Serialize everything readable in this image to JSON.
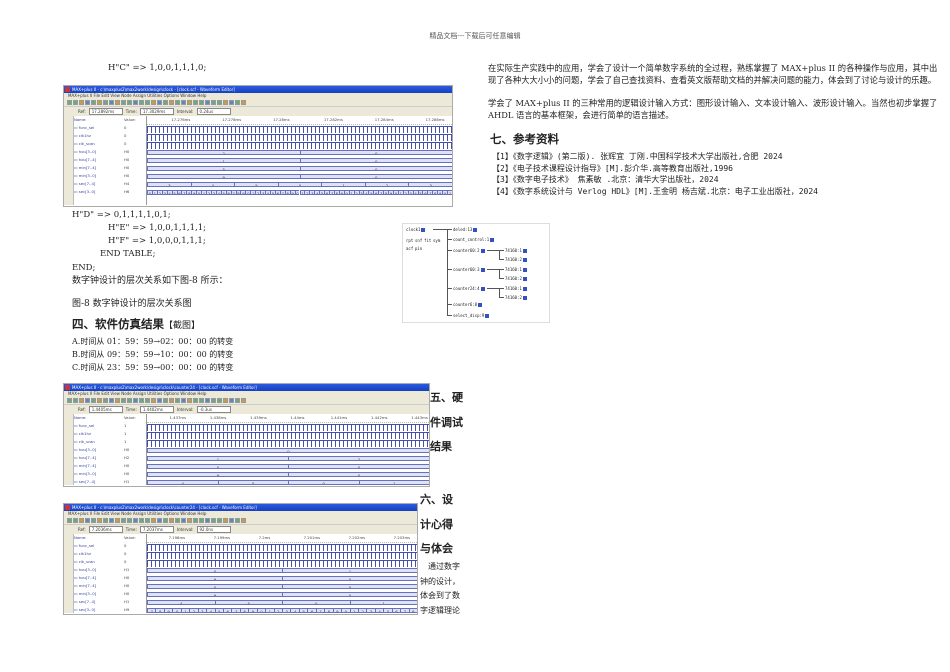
{
  "header": "精品文档---下载后可任意编辑",
  "left": {
    "line_c": "H\"C\"     => 1,0,0,1,1,1,0;",
    "line_d": "H\"D\"     => 0,1,1,1,1,0,1;",
    "line_e": "H\"E\"     => 1,0,0,1,1,1,1;",
    "line_f": "H\"F\"     => 1,0,0,0,1,1,1;",
    "end_table": "END TABLE;",
    "end": "END;",
    "hier_intro": "数字钟设计的层次关系如下图-8 所示：",
    "fig_caption": "图-8   数字钟设计的层次关系图",
    "sec4_title": "四、软件仿真结果",
    "sec4_note": "【截图】",
    "case_a": "A.时间从 01：59：59→02：00：00 的转变",
    "case_b": "B.时间从 09：59：59→10：00：00 的转变",
    "case_c": "C.时间从 23：59：59→00：00：00 的转变",
    "sec5_title": "五、硬件调试结果",
    "sec6_title": "六、设计心得与体会",
    "sec6_text": "通过数字钟的设计，体会到了数字逻辑理论"
  },
  "right": {
    "p1": "在实际生产实践中的应用，学会了设计一个简单数字系统的全过程，熟练掌握了 MAX+plus II 的各种操作与应用，其中出现了各种大大小小的问题，学会了自己查找资料、查看英文版帮助文档的并解决问题的能力，体会到了讨论与设计的乐趣。",
    "p2": "学会了 MAX+plus II 的三种常用的逻辑设计输入方式：图形设计输入、文本设计输入、波形设计输入。当然也初步掌握了 AHDL 语言的基本框架，会进行简单的语言描述。",
    "sec7_title": "七、参考资料",
    "refs": [
      "【1】《数字逻辑》(第二版). 张辉宜 丁刚.中国科学技术大学出版社,合肥 2024",
      "【2】《电子技术课程设计指导》[M].彭介华.高等教育出版社,1996",
      "【3】《数字电子技术》  焦素敏 .北京：清华大学出版社，2024",
      "【4】《数字系统设计与 Verlog HDL》[M].王金明 杨吉斌.北京：电子工业出版社，2024"
    ]
  },
  "hierarchy": {
    "root": "clock1",
    "children": [
      "deled:13",
      "count_control:1",
      "counter60:2",
      "counter60:3",
      "counter24:4",
      "counter6:8",
      "select_disp:9"
    ],
    "sub": "74160",
    "tags": [
      "rpt",
      "snf",
      "fit",
      "sym",
      "acf",
      "pin"
    ]
  },
  "waveforms": [
    {
      "title": "MAX+plus II - c:\\maxplus2\\max2work\\design\\clock - [clock.scf - Waveform Editor]",
      "menu": "MAX+plus II  File  Edit  View  Node  Assign  Utilities  Options  Window  Help",
      "ref_label": "Ref:",
      "ref": "17.2892ms",
      "time_label": "Time:",
      "time": "17.3029ms",
      "interval_label": "Interval:",
      "interval": "0.24us",
      "ticks": [
        "17.276ms",
        "17.278ms",
        "17.28ms",
        "17.282ms",
        "17.284ms",
        "17.286ms"
      ],
      "signals": [
        {
          "name": "func_sel",
          "value": "0",
          "type": "clk"
        },
        {
          "name": "clk1hz",
          "value": "0",
          "type": "clk"
        },
        {
          "name": "clk_scan",
          "value": "0",
          "type": "clk"
        },
        {
          "name": "hou[3..0]",
          "value": "H0",
          "segs": [
            "2",
            "0"
          ]
        },
        {
          "name": "hou[7..4]",
          "value": "H0",
          "segs": [
            "1",
            "0"
          ]
        },
        {
          "name": "min[7..4]",
          "value": "H0",
          "segs": [
            "5",
            "0"
          ]
        },
        {
          "name": "min[3..0]",
          "value": "H0",
          "segs": [
            "9",
            "0"
          ]
        },
        {
          "name": "sec[7..4]",
          "value": "H4",
          "segs": [
            "3",
            "4",
            "5",
            "0",
            "1",
            "2",
            "3"
          ]
        },
        {
          "name": "sec[3..0]",
          "value": "H6",
          "segs": [
            "0",
            "1",
            "2",
            "3",
            "4",
            "5",
            "6",
            "7",
            "8",
            "9",
            "0",
            "1",
            "2",
            "3",
            "4",
            "5",
            "6",
            "7",
            "8",
            "9",
            "0",
            "1",
            "2",
            "3",
            "4",
            "5",
            "6",
            "7",
            "8",
            "9",
            "0",
            "1",
            "2",
            "3",
            "4",
            "5",
            "6",
            "7",
            "8",
            "9",
            "0",
            "1",
            "2",
            "3",
            "4",
            "5",
            "6",
            "7",
            "8",
            "9",
            "0",
            "1",
            "2",
            "3",
            "4",
            "5",
            "6",
            "7",
            "8",
            "9",
            "0",
            "1"
          ]
        }
      ]
    },
    {
      "title": "MAX+plus II - c:\\maxplus2\\max2work\\design\\clock\\counter24 - [clock.scf - Waveform Editor]",
      "menu": "MAX+plus II  File  Edit  View  Node  Assign  Utilities  Options  Window  Help",
      "ref_label": "Ref:",
      "ref": "1.4405ms",
      "time_label": "Time:",
      "time": "1.4402ms",
      "interval_label": "Interval:",
      "interval": "-0.3us",
      "ticks": [
        "1.437ms",
        "1.438ms",
        "1.439ms",
        "1.44ms",
        "1.441ms",
        "1.442ms",
        "1.443ms"
      ],
      "signals": [
        {
          "name": "func_sel",
          "value": "1",
          "type": "clk"
        },
        {
          "name": "clk1hz",
          "value": "1",
          "type": "clk"
        },
        {
          "name": "clk_scan",
          "value": "1",
          "type": "clk"
        },
        {
          "name": "hou[3..0]",
          "value": "H0",
          "segs": [
            "0"
          ]
        },
        {
          "name": "hou[7..4]",
          "value": "H2",
          "segs": [
            "1",
            "2"
          ]
        },
        {
          "name": "min[7..4]",
          "value": "H0",
          "segs": [
            "5",
            "0"
          ]
        },
        {
          "name": "min[3..0]",
          "value": "H0",
          "segs": [
            "9",
            "0"
          ]
        },
        {
          "name": "sec[7..4]",
          "value": "H1",
          "segs": [
            "4",
            "5",
            "0",
            "1"
          ]
        },
        {
          "name": "sec[3..0]",
          "value": "H8",
          "segs": [
            "2",
            "3",
            "4",
            "5",
            "6",
            "7",
            "8",
            "9",
            "0",
            "1",
            "2",
            "3",
            "4",
            "5",
            "6",
            "7",
            "8",
            "9",
            "0",
            "1",
            "2",
            "3",
            "4",
            "5",
            "6",
            "7",
            "8",
            "9",
            "0",
            "1",
            "2",
            "3",
            "4",
            "5",
            "6",
            "7",
            "8",
            "9",
            "0",
            "1",
            "2",
            "3"
          ]
        }
      ]
    },
    {
      "title": "MAX+plus II - c:\\maxplus2\\max2work\\design\\clock\\counter24 - [clock.scf - Waveform Editor]",
      "menu": "MAX+plus II  File  Edit  View  Node  Assign  Utilities  Options  Window  Help",
      "ref_label": "Ref:",
      "ref": "7.2036ms",
      "time_label": "Time:",
      "time": "7.2037ms",
      "interval_label": "Interval:",
      "interval": "92.0ns",
      "ticks": [
        "7.198ms",
        "7.199ms",
        "7.2ms",
        "7.201ms",
        "7.202ms",
        "7.203ms"
      ],
      "signals": [
        {
          "name": "func_sel",
          "value": "0",
          "type": "clk"
        },
        {
          "name": "clk1hz",
          "value": "0",
          "type": "clk"
        },
        {
          "name": "clk_scan",
          "value": "0",
          "type": "clk"
        },
        {
          "name": "hou[3..0]",
          "value": "H1",
          "segs": [
            "0",
            "1"
          ]
        },
        {
          "name": "hou[7..4]",
          "value": "H0",
          "segs": [
            "9",
            "0"
          ]
        },
        {
          "name": "min[7..4]",
          "value": "H0",
          "segs": [
            "5",
            "0"
          ]
        },
        {
          "name": "min[3..0]",
          "value": "H0",
          "segs": [
            "9",
            "0"
          ]
        },
        {
          "name": "sec[7..4]",
          "value": "H1",
          "segs": [
            "4",
            "5",
            "0",
            "1"
          ]
        },
        {
          "name": "sec[3..0]",
          "value": "H9",
          "segs": [
            "7",
            "8",
            "9",
            "0",
            "1",
            "2",
            "3",
            "4",
            "5",
            "6",
            "7",
            "8",
            "9",
            "0",
            "1",
            "2",
            "3",
            "4",
            "5",
            "6",
            "7",
            "8",
            "9",
            "0",
            "1",
            "2",
            "3",
            "4",
            "5",
            "6",
            "7",
            "8"
          ]
        }
      ]
    }
  ]
}
